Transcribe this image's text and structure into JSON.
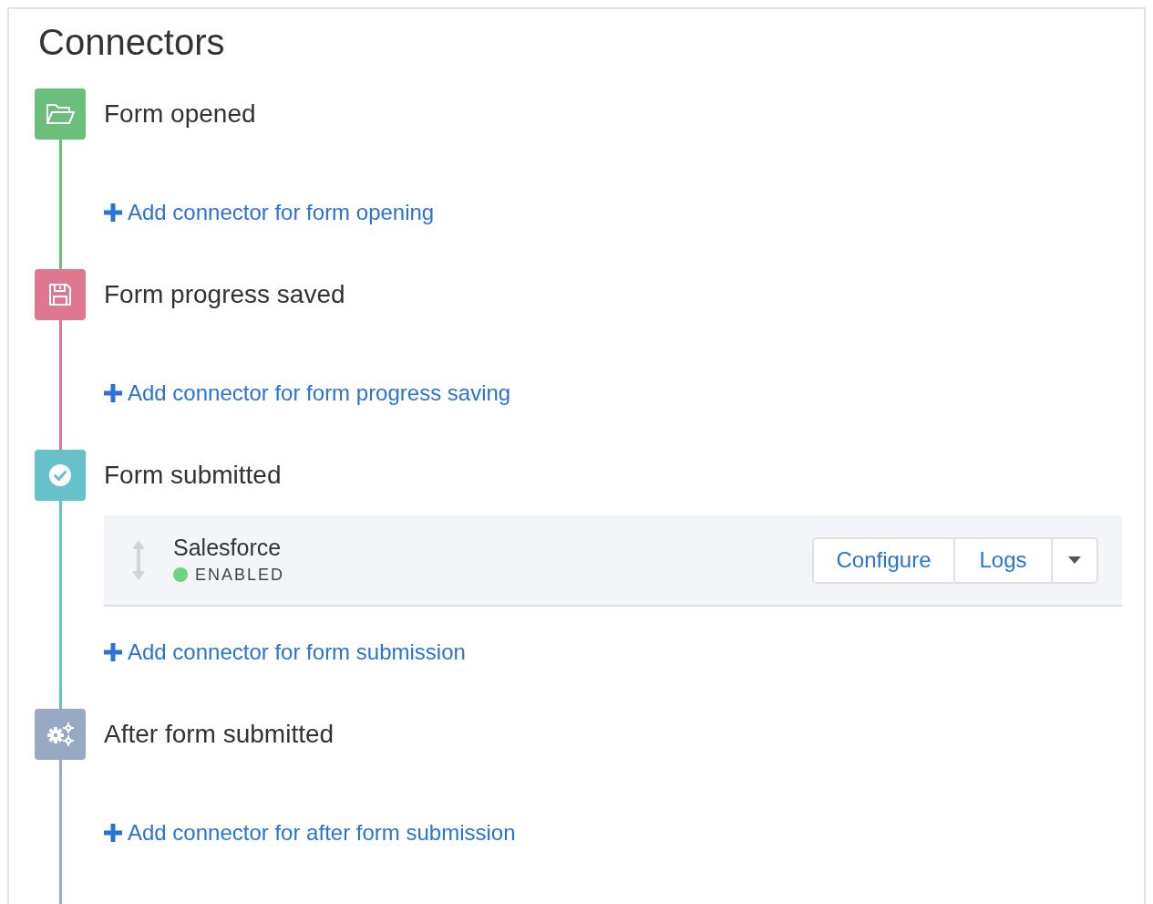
{
  "title": "Connectors",
  "stages": [
    {
      "title": "Form opened",
      "kind": "folder",
      "color": "#6bbf7a",
      "add_link": "Add connector for form opening"
    },
    {
      "title": "Form progress saved",
      "kind": "save",
      "color": "#e07791",
      "add_link": "Add connector for form progress saving"
    },
    {
      "title": "Form submitted",
      "kind": "check",
      "color": "#67c1ca",
      "add_link": "Add connector for form submission",
      "connectors": [
        {
          "name": "Salesforce",
          "status": "ENABLED",
          "enabled": true,
          "buttons": [
            "Configure",
            "Logs"
          ]
        }
      ]
    },
    {
      "title": "After form submitted",
      "kind": "gears",
      "color": "#97a9c4",
      "add_link": "Add connector for after form submission"
    }
  ]
}
